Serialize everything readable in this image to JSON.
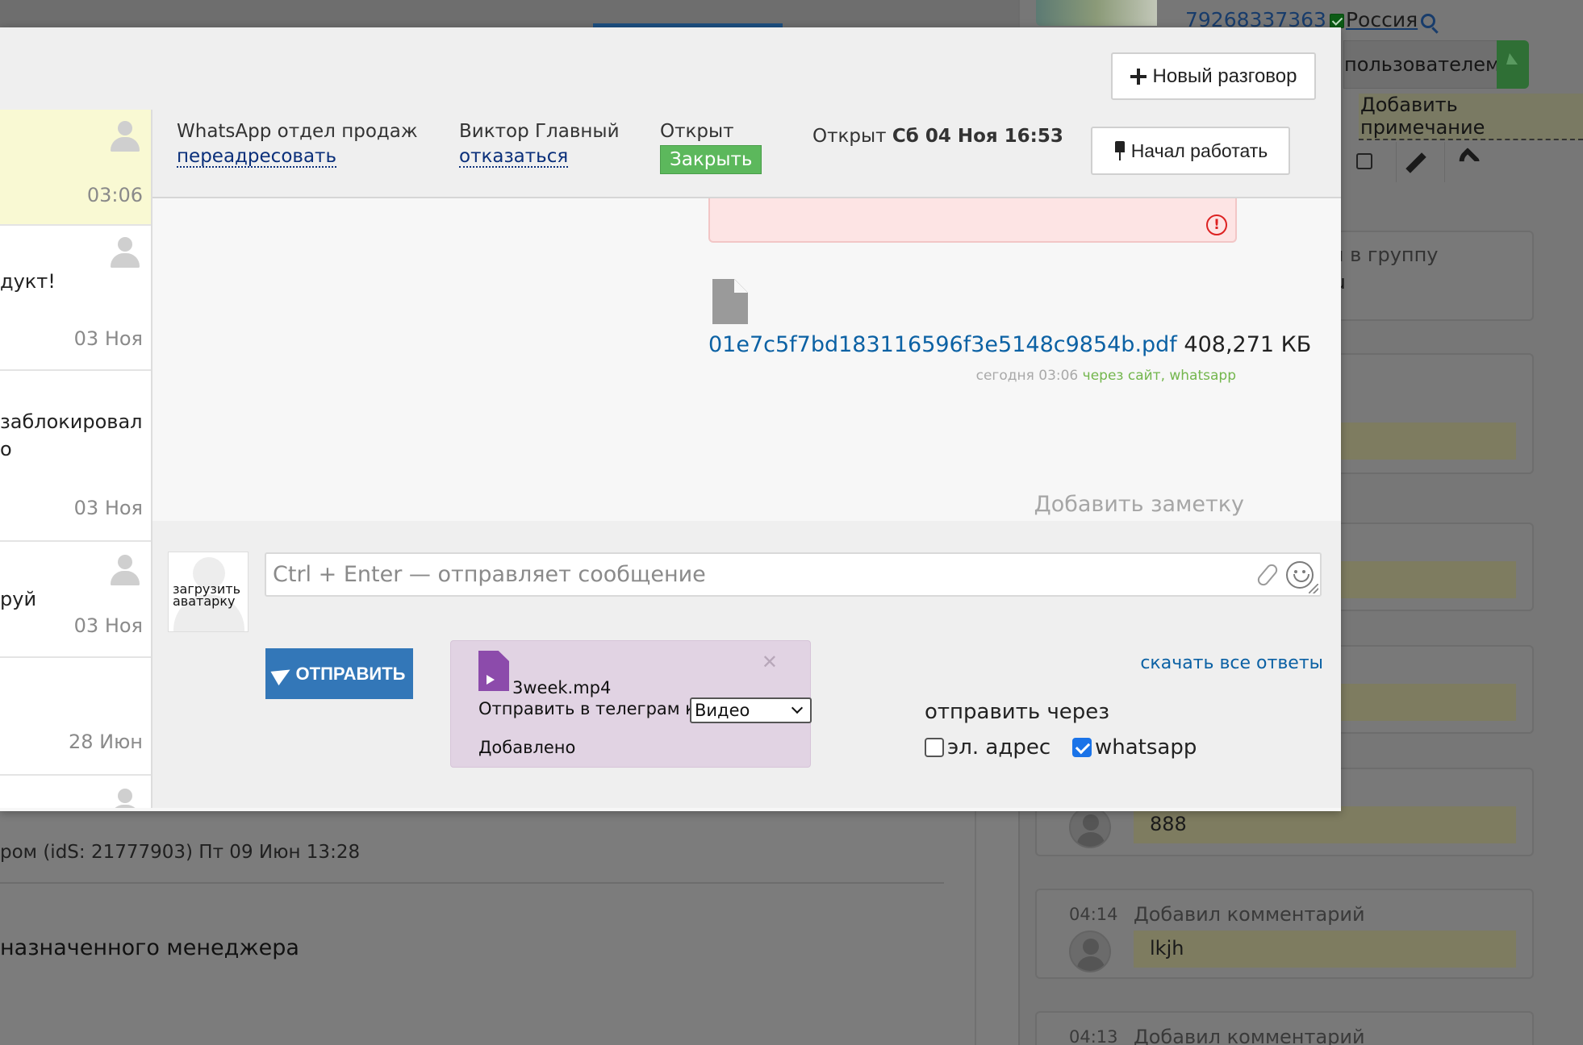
{
  "background": {
    "contact_phone": "79268337363",
    "contact_country": "Россия",
    "user_button_label": "пользователем",
    "add_note_label": "Добавить примечание",
    "event_text_1": "ром (idS: 21777903) Пт 09 Июн 13:28",
    "event_text_2": "назначенного менеджера",
    "cards": [
      {
        "text_a": "ен в группу",
        "text_b": ".ru"
      },
      {
        "time": "",
        "title": "",
        "value": "888"
      },
      {
        "time": "04:14",
        "title": "Добавил комментарий",
        "value": "lkjh"
      },
      {
        "time": "04:13",
        "title": "Добавил комментарий"
      }
    ]
  },
  "modal": {
    "new_conversation_label": "Новый разговор",
    "conversations": [
      {
        "text": "",
        "date": "03:06",
        "active": true
      },
      {
        "text": "дукт!",
        "date": "03 Ноя"
      },
      {
        "text_line1": " заблокировал",
        "text_line2": "о",
        "date": "03 Ноя"
      },
      {
        "text": "руй",
        "date": "03 Ноя"
      },
      {
        "text": "",
        "date": "28 Июн"
      }
    ],
    "header": {
      "channel": "WhatsApp отдел продаж",
      "redirect_link": "переадресовать",
      "manager": "Виктор Главный",
      "decline_link": "отказаться",
      "status": "Открыт",
      "close_label": "Закрыть",
      "opened_prefix": "Открыт",
      "opened_at": "Сб 04 Ноя 16:53",
      "start_work_label": "Начал работать"
    },
    "message": {
      "file_name": "01e7c5f7bd183116596f3e5148c9854b.pdf",
      "file_size": "408,271 КБ",
      "sent_when": "сегодня 03:06",
      "sent_via": "через сайт, whatsapp",
      "add_note": "Добавить заметку"
    },
    "composer": {
      "upload_avatar": "загрузить аватарку",
      "placeholder": "Ctrl + Enter — отправляет сообщение",
      "send_label": "ОТПРАВИТЬ",
      "attachment": {
        "name": "3week.mp4",
        "send_as_label": "Отправить в телеграм как:",
        "send_as_value": "Видео",
        "status": "Добавлено"
      },
      "download_all": "скачать все ответы",
      "send_via_label": "отправить через",
      "channels": [
        {
          "label": "эл. адрес",
          "checked": false
        },
        {
          "label": "whatsapp",
          "checked": true
        }
      ]
    }
  }
}
